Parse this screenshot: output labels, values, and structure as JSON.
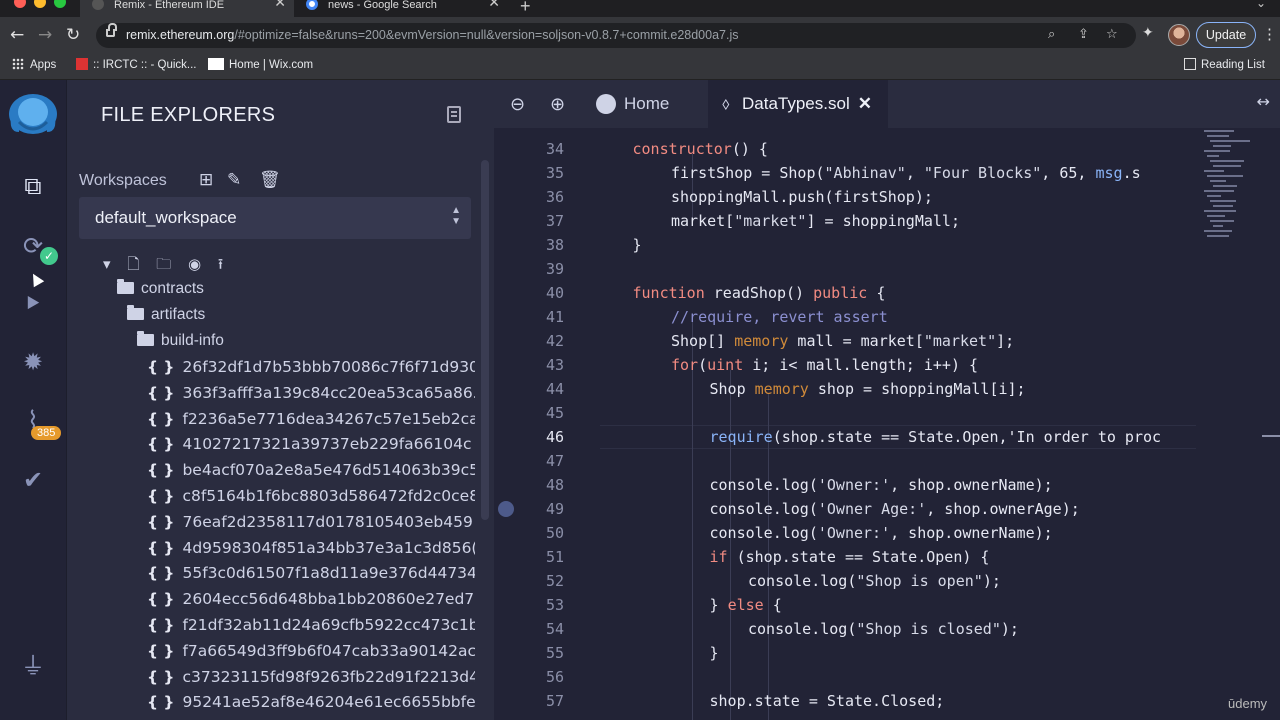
{
  "browser": {
    "tabs": [
      {
        "title": "Remix - Ethereum IDE",
        "close": "✕"
      },
      {
        "title": "news - Google Search",
        "close": "✕"
      }
    ],
    "new_tab": "+",
    "url_host": "remix.ethereum.org",
    "url_rest": "/#optimize=false&runs=200&evmVersion=null&version=soljson-v0.8.7+commit.e28d00a7.js",
    "update_label": "Update",
    "bookmarks": [
      {
        "label": "Apps",
        "icon": "apps-grid-icon"
      },
      {
        "label": ":: IRCTC :: - Quick...",
        "icon": "irctc-icon"
      },
      {
        "label": "Home | Wix.com",
        "icon": "wix-icon"
      }
    ],
    "reading_list": "Reading List"
  },
  "icon_panel": {
    "icons": [
      "file-explorer-icon",
      "compiler-icon",
      "deploy-icon",
      "debugger-icon",
      "analysis-icon",
      "testing-icon",
      "plugin-manager-icon"
    ],
    "badge_count": "385"
  },
  "side_panel": {
    "title": "FILE EXPLORERS",
    "workspaces_label": "Workspaces",
    "workspace_value": "default_workspace",
    "folders": [
      {
        "label": "contracts"
      },
      {
        "label": "artifacts"
      },
      {
        "label": "build-info"
      }
    ],
    "file_brace": "{ }",
    "files": [
      "26f32df1d7b53bbb70086c7f6f71d930",
      "363f3afff3a139c84cc20ea53ca65a86.j",
      "f2236a5e7716dea34267c57e15eb2ca",
      "41027217321a39737eb229fa66104c",
      "be4acf070a2e8a5e476d514063b39c5",
      "c8f5164b1f6bc8803d586472fd2c0ce8",
      "76eaf2d2358117d0178105403eb459",
      "4d9598304f851a34bb37e3a1c3d856(",
      "55f3c0d61507f1a8d11a9e376d44734",
      "2604ecc56d648bba1bb20860e27ed7(",
      "f21df32ab11d24a69cfb5922cc473c1b",
      "f7a66549d3ff9b6f047cab33a90142ac",
      "c37323115fd98f9263fb22d91f2213d4",
      "95241ae52af8e46204e61ec6655bbfe("
    ]
  },
  "editor": {
    "tabs": [
      {
        "label": "Home"
      },
      {
        "label": "DataTypes.sol",
        "close": "✕"
      }
    ],
    "current_line": "46",
    "line_numbers": [
      "34",
      "35",
      "36",
      "37",
      "38",
      "39",
      "40",
      "41",
      "42",
      "43",
      "44",
      "45",
      "46",
      "47",
      "48",
      "49",
      "50",
      "51",
      "52",
      "53",
      "54",
      "55",
      "56",
      "57"
    ],
    "lines": [
      "constructor() {",
      "firstShop = Shop(\"Abhinav\", \"Four Blocks\", 65, msg.s",
      "shoppingMall.push(firstShop);",
      "market[\"market\"] = shoppingMall;",
      "}",
      "",
      "function readShop() public {",
      "//require, revert assert",
      "Shop[] memory mall = market[\"market\"];",
      "for(uint i; i< mall.length; i++) {",
      "Shop memory shop = shoppingMall[i];",
      "",
      "require(shop.state == State.Open,'In order to proc",
      "",
      "console.log('Owner:', shop.ownerName);",
      "console.log('Owner Age:', shop.ownerAge);",
      "console.log('Owner:', shop.ownerName);",
      "if (shop.state == State.Open) {",
      "console.log(\"Shop is open\");",
      "} else {",
      "console.log(\"Shop is closed\");",
      "}",
      "",
      "shop.state = State.Closed;"
    ]
  },
  "watermark": "ūdemy"
}
